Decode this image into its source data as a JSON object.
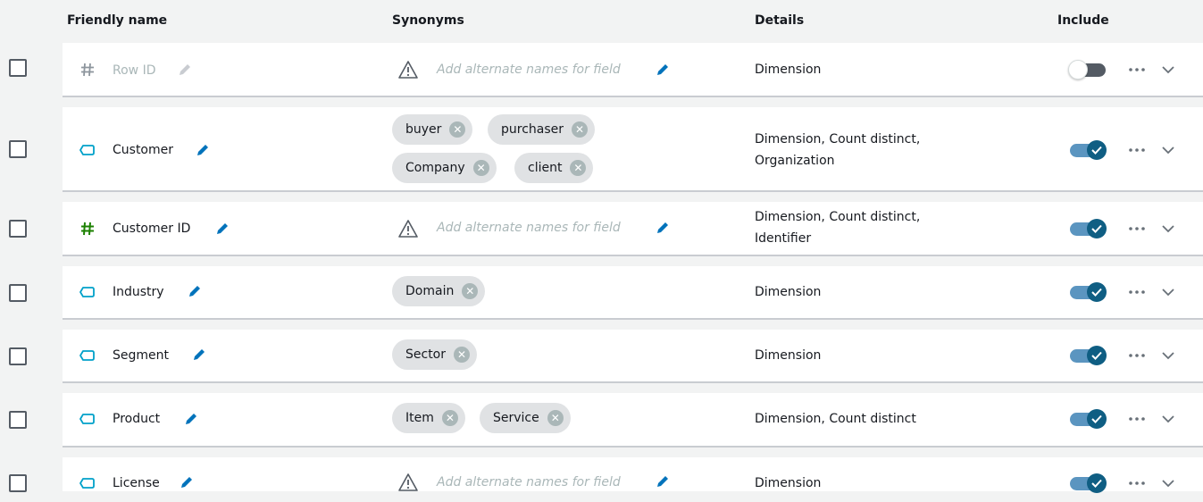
{
  "header": {
    "friendly_name": "Friendly name",
    "synonyms": "Synonyms",
    "details": "Details",
    "include": "Include"
  },
  "placeholder_text": "Add alternate names for field",
  "colors": {
    "accent": "#0073bb",
    "toggle_on": "#0f5e83",
    "chip_bg": "#e0e2e4",
    "dimension_icon": "#00a1c9",
    "measure_icon": "#1d8102"
  },
  "rows": [
    {
      "name": "Row ID",
      "icon": "hash-icon",
      "include": false,
      "synonyms": [],
      "details": "Dimension"
    },
    {
      "name": "Customer",
      "icon": "dimension-tag-icon",
      "include": true,
      "synonyms": [
        "buyer",
        "purchaser",
        "Company",
        "client"
      ],
      "details": "Dimension, Count distinct, Organization"
    },
    {
      "name": "Customer ID",
      "icon": "hash-icon",
      "include": true,
      "synonyms": [],
      "details": "Dimension, Count distinct, Identifier"
    },
    {
      "name": "Industry",
      "icon": "dimension-tag-icon",
      "include": true,
      "synonyms": [
        "Domain"
      ],
      "details": "Dimension"
    },
    {
      "name": "Segment",
      "icon": "dimension-tag-icon",
      "include": true,
      "synonyms": [
        "Sector"
      ],
      "details": "Dimension"
    },
    {
      "name": "Product",
      "icon": "dimension-tag-icon",
      "include": true,
      "synonyms": [
        "Item",
        "Service"
      ],
      "details": "Dimension, Count distinct"
    },
    {
      "name": "License",
      "icon": "dimension-tag-icon",
      "include": true,
      "synonyms": [],
      "details": "Dimension"
    }
  ]
}
